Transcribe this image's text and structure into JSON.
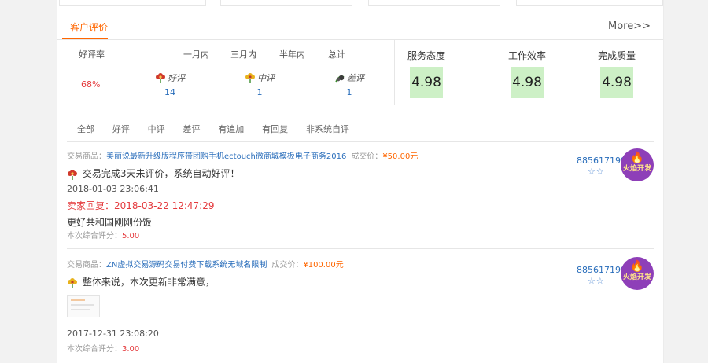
{
  "tabs": {
    "active": "客户评价",
    "more": "More>>"
  },
  "stats": {
    "headers": {
      "rate": "好评率",
      "month": "一月内",
      "three_months": "三月内",
      "half_year": "半年内",
      "total": "总计"
    },
    "rate_value": "68%",
    "evaluations": [
      {
        "name": "好评",
        "count": "14",
        "icon": "red-flower-icon",
        "color": "#d0392b"
      },
      {
        "name": "中评",
        "count": "1",
        "icon": "yellow-flower-icon",
        "color": "#e8b21c"
      },
      {
        "name": "差评",
        "count": "1",
        "icon": "wilted-flower-icon",
        "color": "#3b3b3b"
      }
    ]
  },
  "scores": [
    {
      "label": "服务态度",
      "value": "4.98"
    },
    {
      "label": "工作效率",
      "value": "4.98"
    },
    {
      "label": "完成质量",
      "value": "4.98"
    }
  ],
  "filters": [
    "全部",
    "好评",
    "中评",
    "差评",
    "有追加",
    "有回复",
    "非系统自评"
  ],
  "reviews": [
    {
      "product_label": "交易商品：",
      "product": "美丽说最新升级版程序带团购手机ectouch微商城模板电子商务2016",
      "price_label": "成交价：",
      "price": "¥50.00元",
      "content": "交易完成3天未评价，系统自动好评！",
      "date": "2018-01-03 23:06:41",
      "reply_label": "卖家回复：",
      "reply_date": "2018-03-22 12:47:29",
      "reply_text": "更好共和国刚刚份饭",
      "score_label": "本次综合评分：",
      "score": "5.00",
      "user": "885617199",
      "stars": "☆☆",
      "avatar_text": "火焰开发",
      "icon": "red-flower-icon"
    },
    {
      "product_label": "交易商品：",
      "product": "ZN虚拟交易源码交易付费下载系统无域名限制",
      "price_label": "成交价：",
      "price": "¥100.00元",
      "content": "整体来说，本次更新非常满意，",
      "date": "2017-12-31 23:08:20",
      "score_label": "本次综合评分：",
      "score": "3.00",
      "user": "885617199",
      "stars": "☆☆",
      "avatar_text": "火焰开发",
      "icon": "yellow-flower-icon"
    }
  ]
}
